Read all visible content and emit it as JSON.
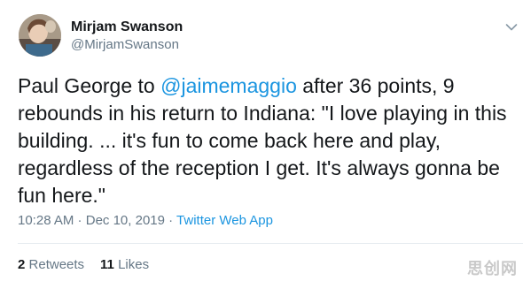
{
  "author": {
    "name": "Mirjam Swanson",
    "handle": "@MirjamSwanson"
  },
  "tweet": {
    "text_before": "Paul George to ",
    "mention": "@jaimemaggio",
    "text_after": " after 36 points, 9 rebounds in his return to Indiana: \"I love playing in this building. ... it's fun to come back here and play, regardless of the reception I get. It's always gonna be fun here.\""
  },
  "meta": {
    "time": "10:28 AM",
    "separator1": " · ",
    "date": "Dec 10, 2019",
    "separator2": " · ",
    "source": "Twitter Web App"
  },
  "stats": {
    "retweets_count": "2",
    "retweets_label": "Retweets",
    "likes_count": "11",
    "likes_label": "Likes"
  },
  "watermark": "思创网",
  "icons": {
    "avatar": "avatar-photo",
    "menu": "chevron-down-icon"
  },
  "colors": {
    "link": "#1b95e0",
    "text": "#14171a",
    "secondary": "#657786"
  }
}
